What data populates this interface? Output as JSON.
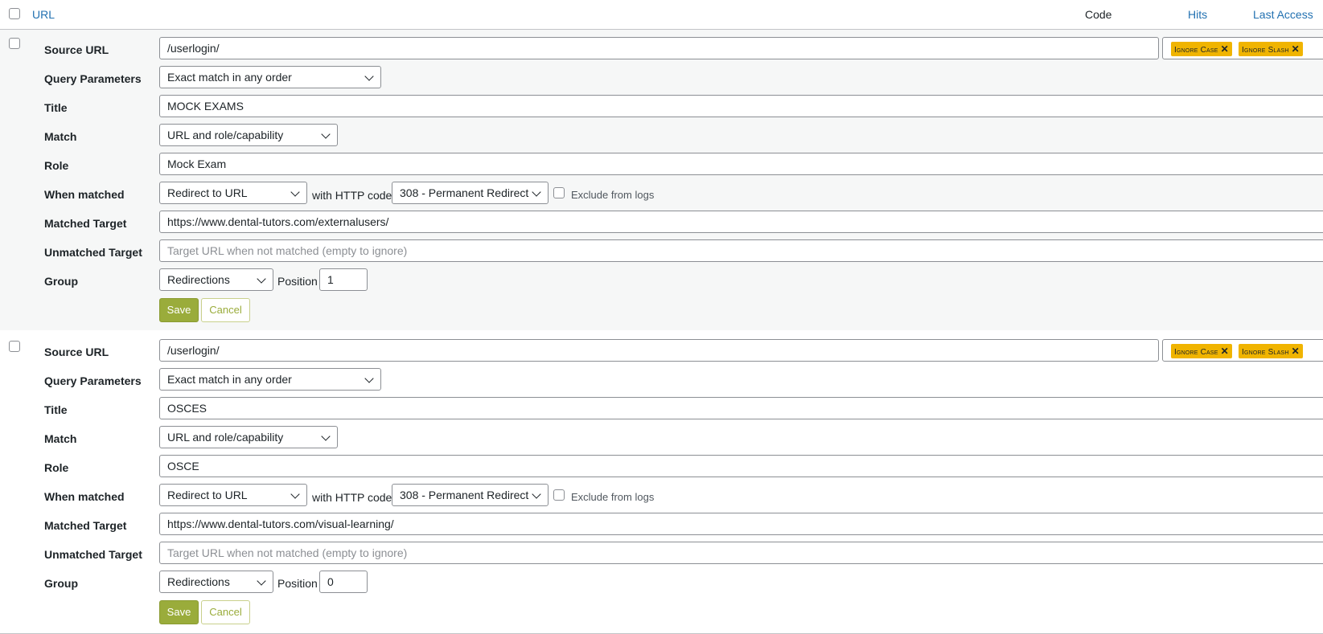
{
  "header": {
    "url_label": "URL",
    "code_label": "Code",
    "hits_label": "Hits",
    "last_access_label": "Last Access"
  },
  "labels": {
    "source_url": "Source URL",
    "query_parameters": "Query Parameters",
    "title": "Title",
    "match": "Match",
    "role": "Role",
    "when_matched": "When matched",
    "matched_target": "Matched Target",
    "unmatched_target": "Unmatched Target",
    "group": "Group",
    "with_http_code": "with HTTP code",
    "exclude_from_logs": "Exclude from logs",
    "position": "Position",
    "save": "Save",
    "cancel": "Cancel",
    "flag_ignore_case": "Ignore Case",
    "flag_ignore_slash": "Ignore Slash",
    "unmatched_placeholder": "Target URL when not matched (empty to ignore)"
  },
  "rows": [
    {
      "source_url": "/userlogin/",
      "query_parameters": "Exact match in any order",
      "title": "MOCK EXAMS",
      "match": "URL and role/capability",
      "role": "Mock Exam",
      "when_matched": "Redirect to URL",
      "http_code": "308 - Permanent Redirect",
      "matched_target": "https://www.dental-tutors.com/externalusers/",
      "unmatched_target": "",
      "group": "Redirections",
      "position": "1"
    },
    {
      "source_url": "/userlogin/",
      "query_parameters": "Exact match in any order",
      "title": "OSCES",
      "match": "URL and role/capability",
      "role": "OSCE",
      "when_matched": "Redirect to URL",
      "http_code": "308 - Permanent Redirect",
      "matched_target": "https://www.dental-tutors.com/visual-learning/",
      "unmatched_target": "",
      "group": "Redirections",
      "position": "0"
    }
  ],
  "colors": {
    "link": "#2271b1",
    "flag_tag": "#f0b400",
    "save_button": "#9aac3b",
    "edit_row_background": "#f6f7f7"
  }
}
